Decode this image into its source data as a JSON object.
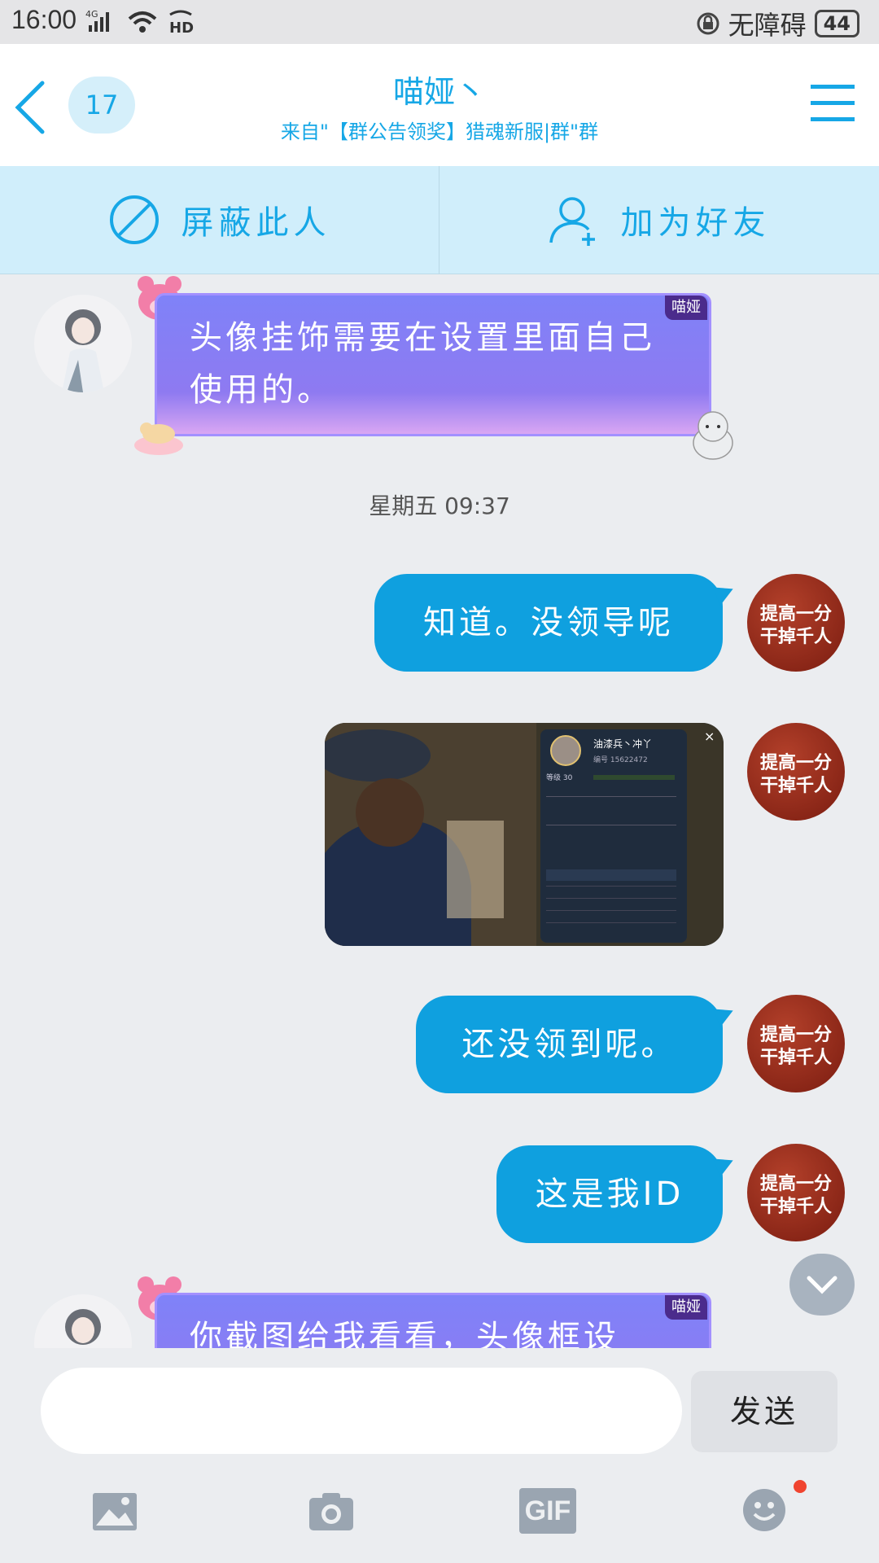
{
  "status_bar": {
    "time": "16:00",
    "network": "4G",
    "hd": "HD",
    "accessibility": "无障碍",
    "battery": "44"
  },
  "header": {
    "back_label": "",
    "unread_count": "17",
    "title": "喵娅丶",
    "subtitle": "来自\"【群公告领奖】猎魂新服|群\"群"
  },
  "actions": {
    "block": "屏蔽此人",
    "add_friend": "加为好友"
  },
  "messages": {
    "m1": {
      "text": "头像挂饰需要在设置里面自己使用的。",
      "tag": "喵娅"
    },
    "time_divider": "星期五 09:37",
    "m2": {
      "text": "知道。没领导呢"
    },
    "m3": {
      "shot_name": "油漆兵丶冲丫",
      "shot_id": "编号 15622472",
      "shot_level": "等级 30"
    },
    "m4": {
      "text": "还没领到呢。"
    },
    "m5": {
      "text": "这是我ID"
    },
    "m6": {
      "text": "你截图给我看看，头像框设",
      "tag": "喵娅"
    }
  },
  "avatar_text": "提高一分 干掉千人",
  "input": {
    "placeholder": "",
    "send_label": "发送"
  },
  "toolbar": {
    "gif_label": "GIF"
  },
  "colors": {
    "accent": "#16a7e6",
    "bubble_blue": "#0fa0df",
    "bubble_purple": "#8e7af1"
  }
}
